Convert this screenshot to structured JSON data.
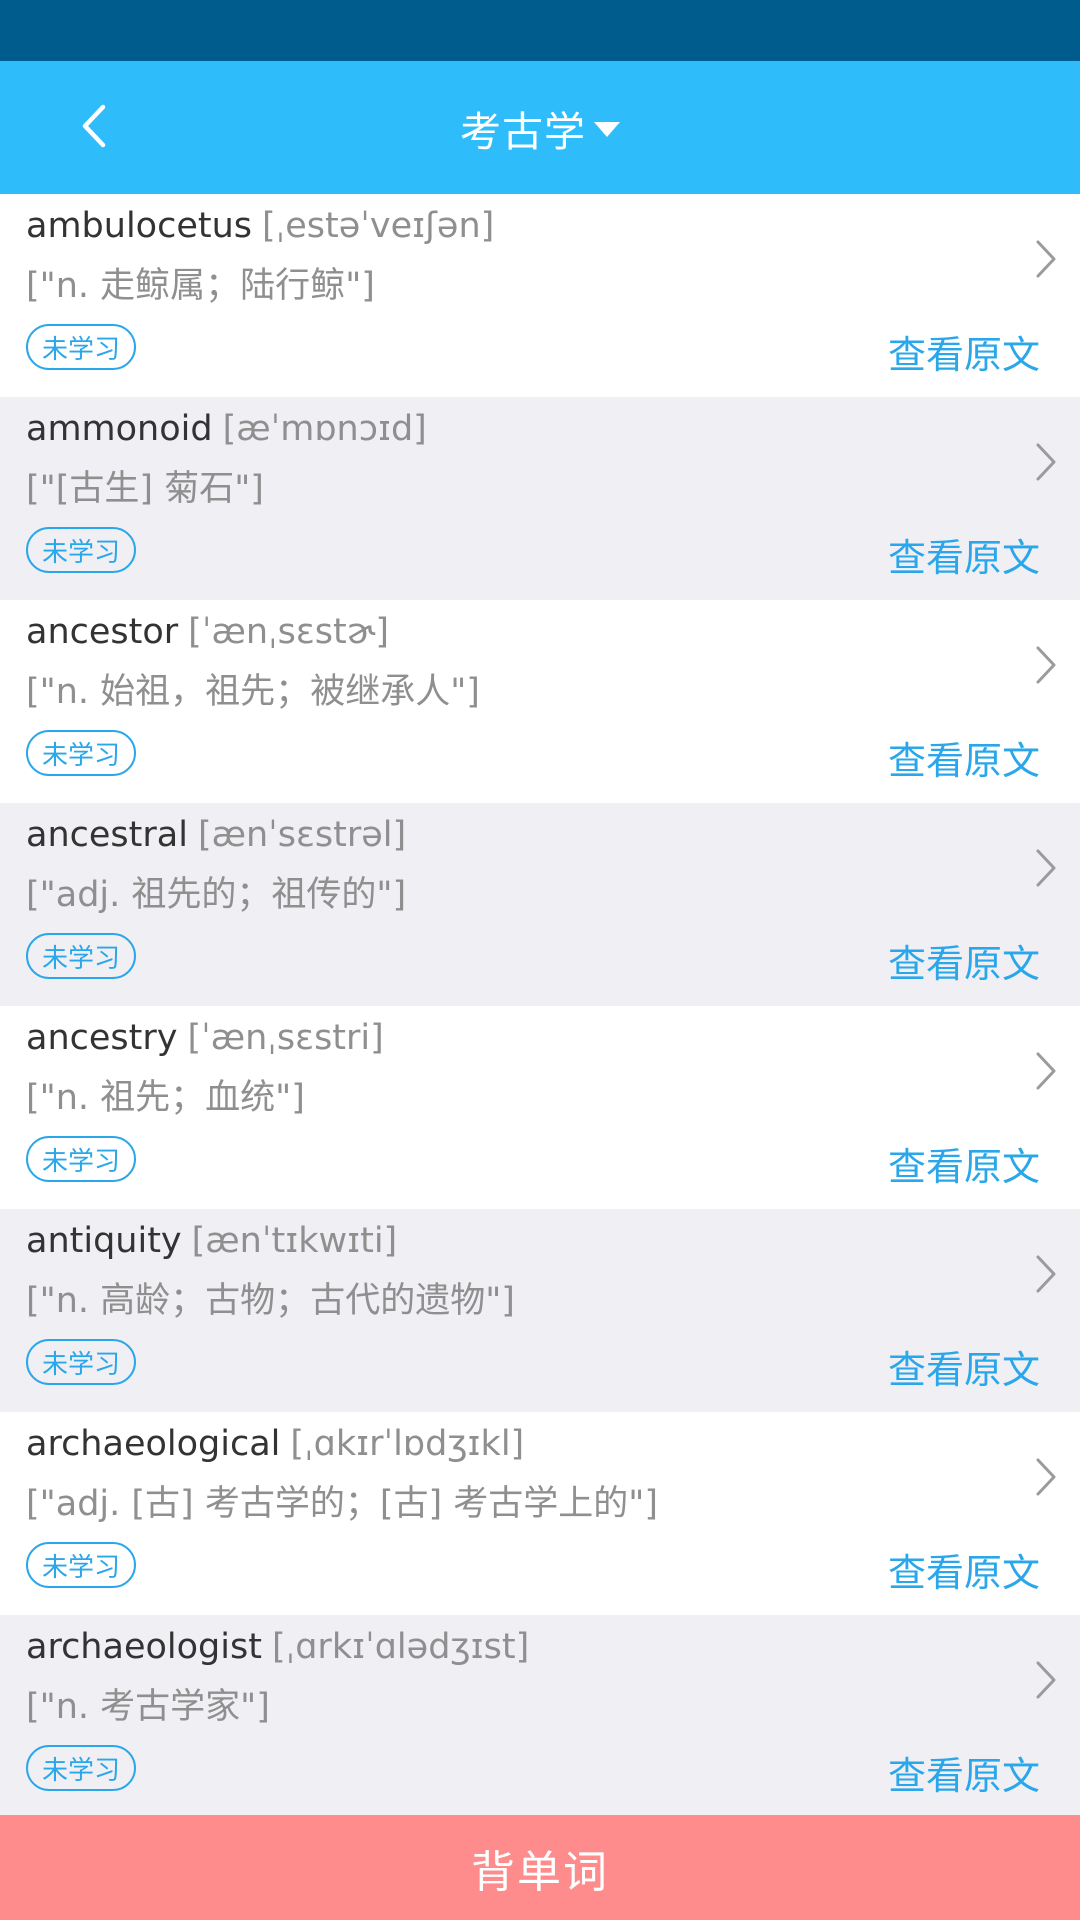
{
  "header": {
    "title": "考古学",
    "back_icon": "back-chevron-icon",
    "dropdown_icon": "caret-down-icon"
  },
  "colors": {
    "status_bar": "#005c8c",
    "header_bg": "#2ebcfb",
    "accent": "#2aa7ea",
    "alt_row_bg": "#efeff4",
    "bottom_button_bg": "#ff8c8c"
  },
  "words": [
    {
      "word": "ambulocetus",
      "phonetic": "[ˌestəˈveɪʃən]",
      "definition": "[\"n. 走鲸属；陆行鲸\"]",
      "status": "未学习",
      "action": "查看原文"
    },
    {
      "word": "ammonoid",
      "phonetic": "[æˈmɒnɔɪd]",
      "definition": "[\"[古生] 菊石\"]",
      "status": "未学习",
      "action": "查看原文"
    },
    {
      "word": "ancestor",
      "phonetic": "[ˈænˌsɛstɚ]",
      "definition": "[\"n. 始祖，祖先；被继承人\"]",
      "status": "未学习",
      "action": "查看原文"
    },
    {
      "word": "ancestral",
      "phonetic": "[ænˈsɛstrəl]",
      "definition": "[\"adj. 祖先的；祖传的\"]",
      "status": "未学习",
      "action": "查看原文"
    },
    {
      "word": "ancestry",
      "phonetic": "[ˈænˌsɛstri]",
      "definition": "[\"n. 祖先；血统\"]",
      "status": "未学习",
      "action": "查看原文"
    },
    {
      "word": "antiquity",
      "phonetic": "[ænˈtɪkwɪti]",
      "definition": "[\"n. 高龄；古物；古代的遗物\"]",
      "status": "未学习",
      "action": "查看原文"
    },
    {
      "word": "archaeological",
      "phonetic": "[ˌɑkɪrˈlɒdʒɪkl]",
      "definition": "[\"adj. [古] 考古学的；[古] 考古学上的\"]",
      "status": "未学习",
      "action": "查看原文"
    },
    {
      "word": "archaeologist",
      "phonetic": "[ˌɑrkɪˈɑlədʒɪst]",
      "definition": "[\"n. 考古学家\"]",
      "status": "未学习",
      "action": "查看原文"
    }
  ],
  "footer": {
    "button_label": "背单词"
  }
}
